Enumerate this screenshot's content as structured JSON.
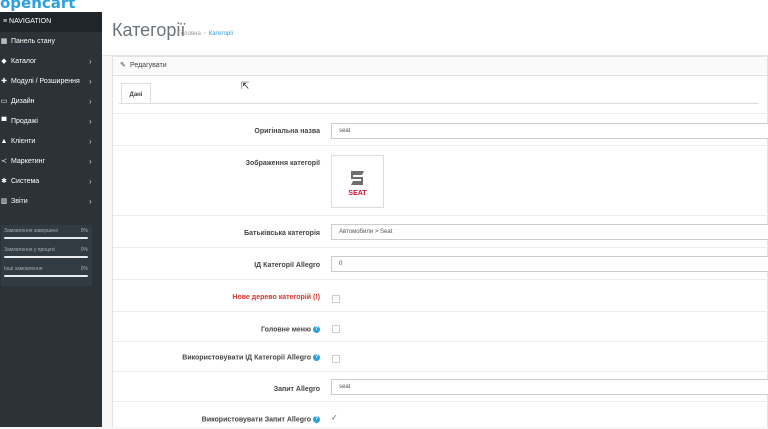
{
  "header": {
    "logo_text": "opencart"
  },
  "sidebar": {
    "nav_title": "NAVIGATION",
    "items": [
      {
        "label": "Панель стану",
        "icon": "dashboard-icon",
        "glyph": "▦"
      },
      {
        "label": "Каталог",
        "icon": "tag-icon",
        "glyph": "◆"
      },
      {
        "label": "Модулі / Розширення",
        "icon": "puzzle-icon",
        "glyph": "✚"
      },
      {
        "label": "Дизайн",
        "icon": "monitor-icon",
        "glyph": "▭"
      },
      {
        "label": "Продажі",
        "icon": "cart-icon",
        "glyph": "▀"
      },
      {
        "label": "Клієнти",
        "icon": "user-icon",
        "glyph": "▲"
      },
      {
        "label": "Маркетинг",
        "icon": "share-icon",
        "glyph": "≺"
      },
      {
        "label": "Система",
        "icon": "gear-icon",
        "glyph": "✱"
      },
      {
        "label": "Звіти",
        "icon": "bar-chart-icon",
        "glyph": "▥"
      }
    ],
    "chevron": "›",
    "stats": [
      {
        "label": "Замовлення завершені",
        "value": "0%"
      },
      {
        "label": "Замовлення у процесі",
        "value": "0%"
      },
      {
        "label": "Інші замовлення",
        "value": "0%"
      }
    ]
  },
  "page": {
    "title": "Категорії",
    "breadcrumb_home": "Головна",
    "breadcrumb_sep": "›",
    "breadcrumb_current": "Категорії"
  },
  "panel": {
    "title": "Редагувати",
    "tab_label": "Дані"
  },
  "form": {
    "original_name_label": "Оригінальна назва",
    "original_name_value": "seat",
    "image_label": "Зображення категорії",
    "image_brand_text": "SEAT",
    "parent_label": "Батьківська категорія",
    "parent_value": "Автомобили > Seat",
    "allegro_id_label": "ІД Категорії Allegro",
    "allegro_id_value": "0",
    "new_tree_label": "Нове дерево категорій (!)",
    "main_menu_label": "Головне меню",
    "use_allegro_id_label": "Використовувати ІД Категорії Allegro",
    "allegro_query_label": "Запит Allegro",
    "allegro_query_value": "seat",
    "use_allegro_query_label": "Використовувати Запит Allegro",
    "use_allegro_query_checked": true,
    "help_glyph": "?"
  },
  "colors": {
    "accent": "#2ea0dd",
    "sidebar_bg": "#2b3338",
    "required_label": "#d8352a",
    "brand_red": "#c8102e"
  }
}
